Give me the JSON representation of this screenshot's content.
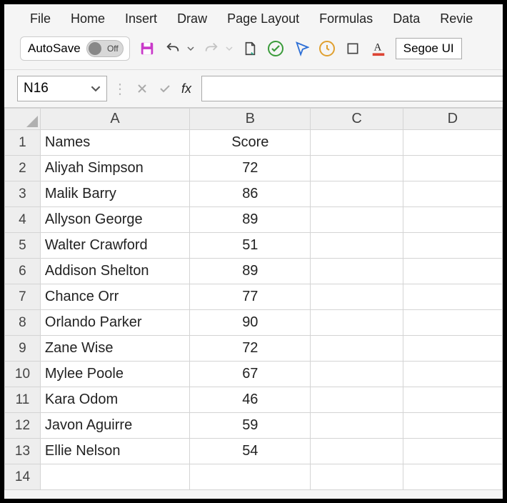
{
  "menu": {
    "file": "File",
    "home": "Home",
    "insert": "Insert",
    "draw": "Draw",
    "page_layout": "Page Layout",
    "formulas": "Formulas",
    "data": "Data",
    "review": "Revie"
  },
  "toolbar": {
    "autosave_label": "AutoSave",
    "autosave_state": "Off",
    "font_name": "Segoe UI"
  },
  "formula_bar": {
    "name_box": "N16",
    "fx": "fx",
    "formula": ""
  },
  "columns": [
    "A",
    "B",
    "C",
    "D"
  ],
  "rows": [
    {
      "n": "1",
      "a": "Names",
      "b": "Score"
    },
    {
      "n": "2",
      "a": "Aliyah Simpson",
      "b": "72"
    },
    {
      "n": "3",
      "a": "Malik Barry",
      "b": "86"
    },
    {
      "n": "4",
      "a": "Allyson George",
      "b": "89"
    },
    {
      "n": "5",
      "a": "Walter Crawford",
      "b": "51"
    },
    {
      "n": "6",
      "a": "Addison Shelton",
      "b": "89"
    },
    {
      "n": "7",
      "a": "Chance Orr",
      "b": "77"
    },
    {
      "n": "8",
      "a": "Orlando Parker",
      "b": "90"
    },
    {
      "n": "9",
      "a": "Zane Wise",
      "b": "72"
    },
    {
      "n": "10",
      "a": "Mylee Poole",
      "b": "67"
    },
    {
      "n": "11",
      "a": "Kara Odom",
      "b": "46"
    },
    {
      "n": "12",
      "a": "Javon Aguirre",
      "b": "59"
    },
    {
      "n": "13",
      "a": "Ellie Nelson",
      "b": "54"
    },
    {
      "n": "14",
      "a": "",
      "b": ""
    }
  ]
}
